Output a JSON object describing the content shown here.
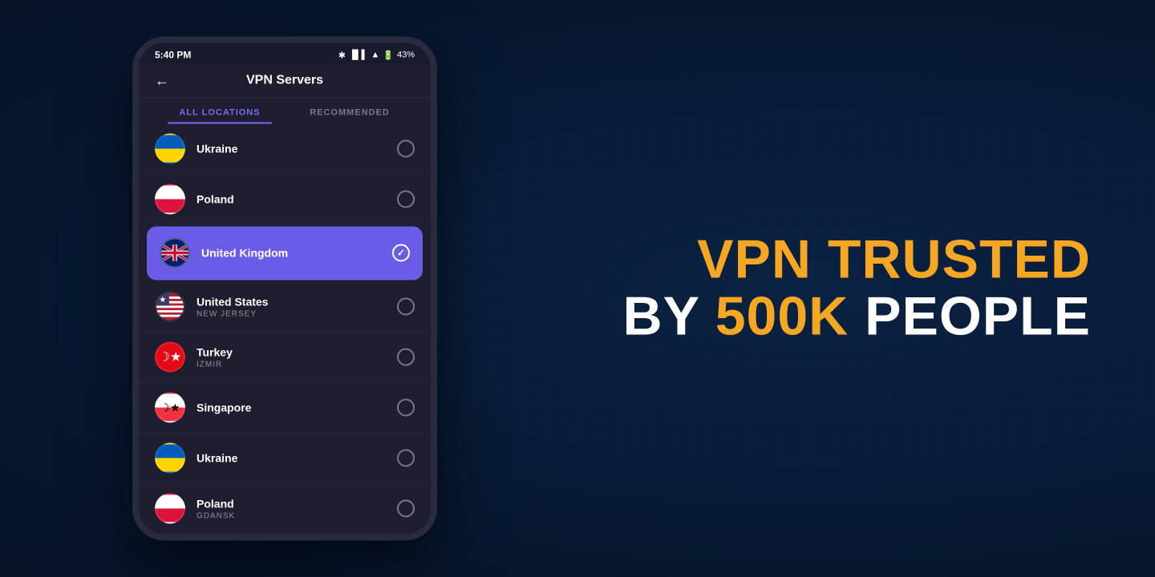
{
  "background": {
    "color": "#0a1f3c"
  },
  "tagline": {
    "line1": "VPN TRUSTED",
    "line2_prefix": "BY ",
    "line2_highlight": "500K",
    "line2_suffix": " People"
  },
  "phone": {
    "status_bar": {
      "time": "5:40 PM",
      "battery": "43%"
    },
    "header": {
      "back_label": "←",
      "title": "VPN Servers"
    },
    "tabs": [
      {
        "label": "ALL LOCATIONS",
        "active": true
      },
      {
        "label": "RECOMMENDED",
        "active": false
      }
    ],
    "servers": [
      {
        "name": "Ukraine",
        "sub": "",
        "flag": "ukraine",
        "selected": false
      },
      {
        "name": "Poland",
        "sub": "",
        "flag": "poland",
        "selected": false
      },
      {
        "name": "United Kingdom",
        "sub": "",
        "flag": "uk",
        "selected": true
      },
      {
        "name": "United States",
        "sub": "NEW JERSEY",
        "flag": "us",
        "selected": false
      },
      {
        "name": "Turkey",
        "sub": "IZMIR",
        "flag": "turkey",
        "selected": false
      },
      {
        "name": "Singapore",
        "sub": "",
        "flag": "singapore",
        "selected": false
      },
      {
        "name": "Ukraine",
        "sub": "",
        "flag": "ukraine",
        "selected": false
      },
      {
        "name": "Poland",
        "sub": "GDANSK",
        "flag": "poland",
        "selected": false
      }
    ]
  }
}
